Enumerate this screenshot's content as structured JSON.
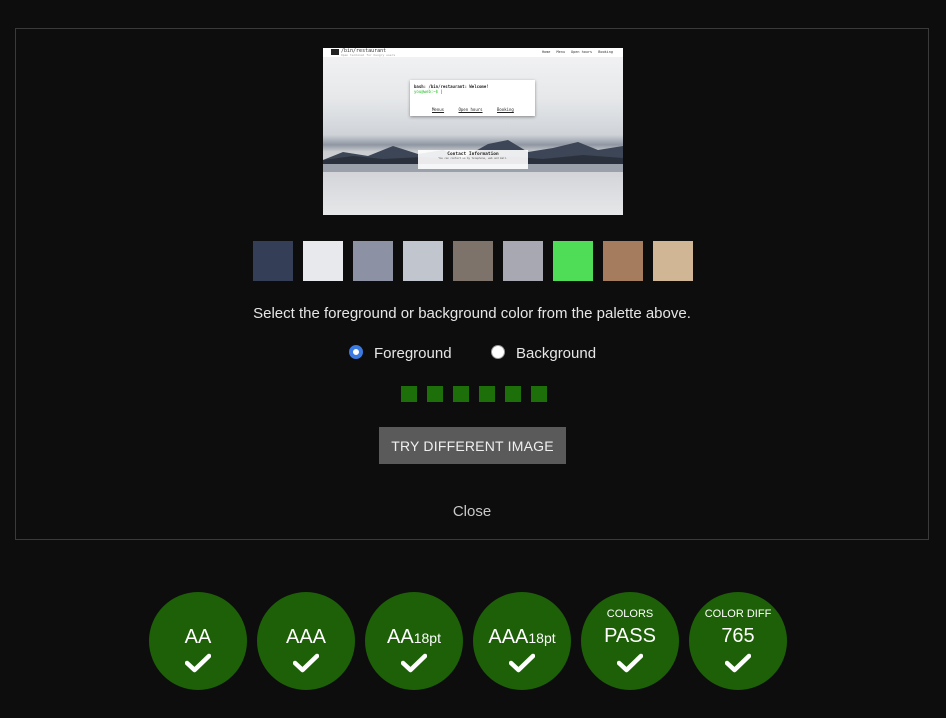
{
  "preview": {
    "site_title": "/bin/restaurant",
    "site_tagline": "Open terminal for hungry users",
    "nav": [
      "Home",
      "Menu",
      "Open hours",
      "Booking"
    ],
    "card_line1": "bash: /bin/restaurant: Welcome!",
    "card_prompt": "you@web:~$",
    "card_links": [
      "Menus",
      "Open hours",
      "Booking"
    ],
    "contact_title": "Contact Information",
    "contact_text": "You can contact us by telephone, web and mail."
  },
  "palette": [
    {
      "name": "swatch-1",
      "color": "#343e57"
    },
    {
      "name": "swatch-2",
      "color": "#e8e9ed"
    },
    {
      "name": "swatch-3",
      "color": "#8c91a3"
    },
    {
      "name": "swatch-4",
      "color": "#c1c5cd"
    },
    {
      "name": "swatch-5",
      "color": "#7e736b"
    },
    {
      "name": "swatch-6",
      "color": "#a8a8b3"
    },
    {
      "name": "swatch-7",
      "color": "#4fdc56"
    },
    {
      "name": "swatch-8",
      "color": "#a57c5e"
    },
    {
      "name": "swatch-9",
      "color": "#d1b696"
    }
  ],
  "instruction": "Select the foreground or background color from the palette above.",
  "radio": {
    "foreground_label": "Foreground",
    "background_label": "Background",
    "selected": "Foreground"
  },
  "selected_color": "#1d6f0a",
  "try_button": "TRY DIFFERENT IMAGE",
  "close_label": "Close",
  "results": [
    {
      "small": "",
      "big": "AA",
      "sub": "",
      "pass": true
    },
    {
      "small": "",
      "big": "AAA",
      "sub": "",
      "pass": true
    },
    {
      "small": "",
      "big": "AA",
      "sub": "18pt",
      "pass": true
    },
    {
      "small": "",
      "big": "AAA",
      "sub": "18pt",
      "pass": true
    },
    {
      "small": "COLORS",
      "big": "PASS",
      "sub": "",
      "pass": true
    },
    {
      "small": "COLOR DIFF",
      "big": "765",
      "sub": "",
      "pass": true
    }
  ],
  "colors": {
    "badge_bg": "#1d6008",
    "button_bg": "#5a5a5a",
    "radio_accent": "#3b7ae0"
  }
}
